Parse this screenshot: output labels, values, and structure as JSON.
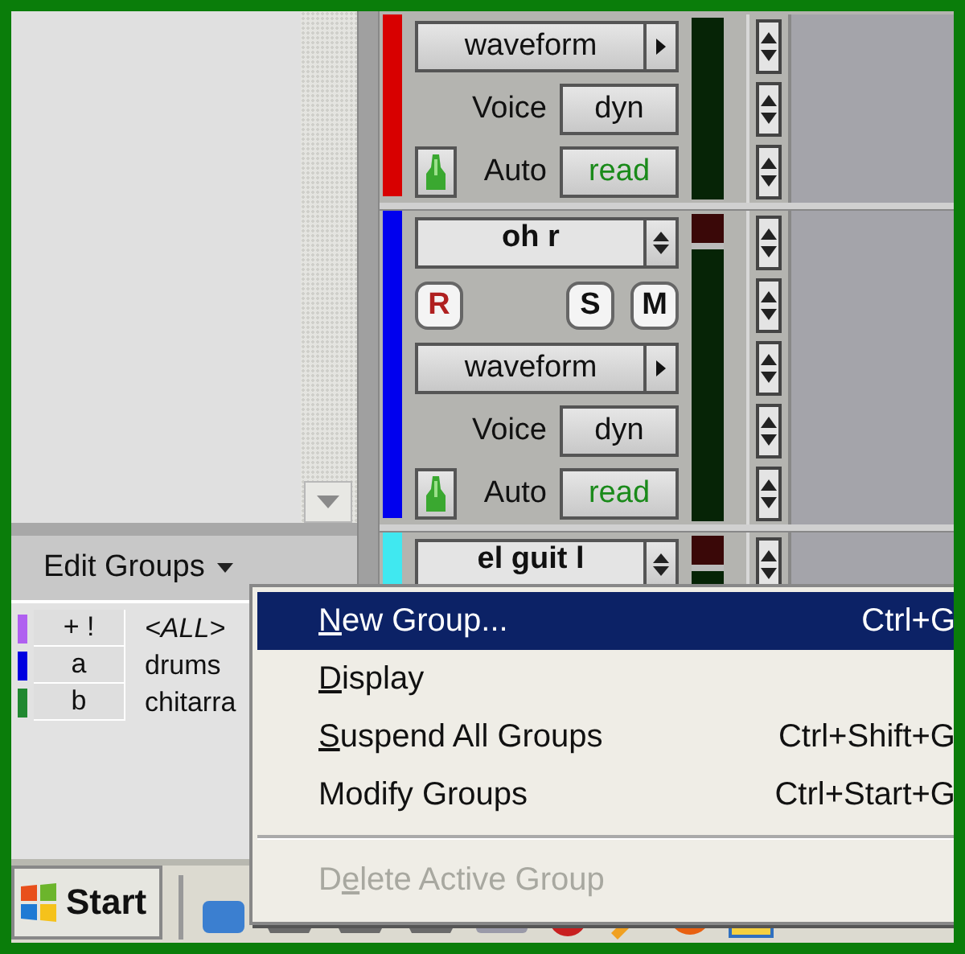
{
  "tracks": [
    {
      "color": "#d80000",
      "clip": false,
      "rows": [
        {
          "kind": "view",
          "label": "waveform"
        },
        {
          "kind": "voice",
          "label": "Voice",
          "value": "dyn"
        },
        {
          "kind": "auto",
          "label": "Auto",
          "value": "read"
        }
      ]
    },
    {
      "color": "#0000ee",
      "clip": true,
      "rows": [
        {
          "kind": "name",
          "label": "oh r"
        },
        {
          "kind": "rsm",
          "buttons": [
            "R",
            "S",
            "M"
          ]
        },
        {
          "kind": "view",
          "label": "waveform"
        },
        {
          "kind": "voice",
          "label": "Voice",
          "value": "dyn"
        },
        {
          "kind": "auto",
          "label": "Auto",
          "value": "read"
        }
      ]
    },
    {
      "color": "#40e8f0",
      "clip": true,
      "rows": [
        {
          "kind": "name",
          "label": "el guit l"
        }
      ]
    }
  ],
  "edit_groups": {
    "title": "Edit Groups",
    "groups": [
      {
        "id": "+ !",
        "name": "<ALL>",
        "color": "#b060f0",
        "all": true
      },
      {
        "id": "a",
        "name": "drums",
        "color": "#0000e0",
        "all": false
      },
      {
        "id": "b",
        "name": "chitarra",
        "color": "#208830",
        "all": false
      }
    ]
  },
  "menu": {
    "items": [
      {
        "kind": "item",
        "label": {
          "key": "N",
          "post": "ew Group..."
        },
        "shortcut": "Ctrl+G",
        "selected": true,
        "disabled": false
      },
      {
        "kind": "item",
        "label": {
          "key": "D",
          "post": "isplay"
        },
        "selected": false,
        "disabled": false
      },
      {
        "kind": "item",
        "label": {
          "key": "S",
          "post": "uspend All Groups"
        },
        "shortcut": "Ctrl+Shift+G",
        "selected": false,
        "disabled": false
      },
      {
        "kind": "item",
        "label": {
          "pre": "Modify Groups"
        },
        "shortcut": "Ctrl+Start+G",
        "selected": false,
        "disabled": false
      },
      {
        "kind": "separator"
      },
      {
        "kind": "item",
        "label": {
          "pre": "D",
          "key": "e",
          "post": "lete Active Group"
        },
        "selected": false,
        "disabled": true
      }
    ]
  },
  "taskbar": {
    "start": "Start"
  }
}
